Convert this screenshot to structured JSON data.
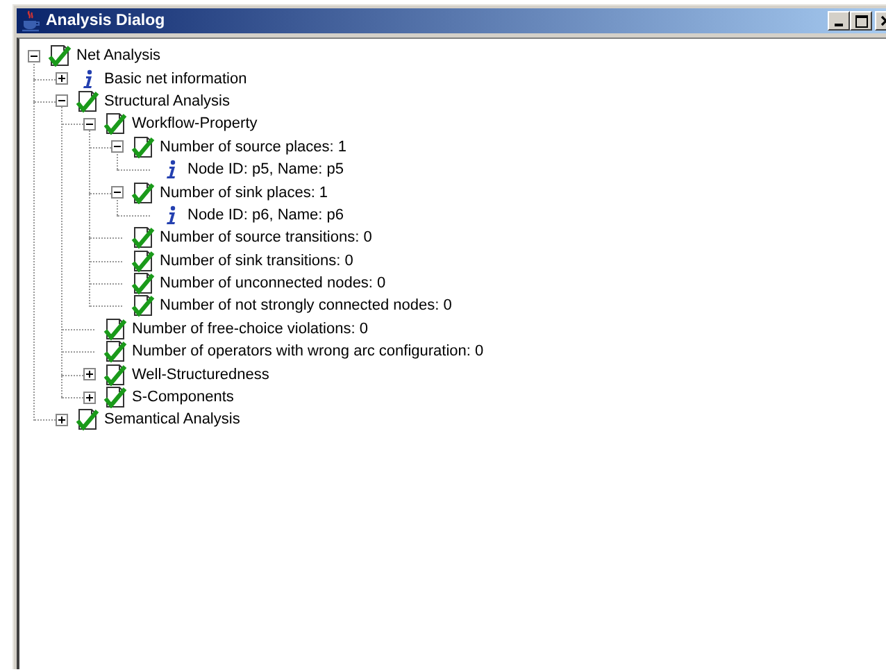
{
  "window": {
    "title": "Analysis Dialog"
  },
  "tree": [
    {
      "label": "Net Analysis",
      "kind": "check",
      "expanded": true,
      "children": [
        {
          "label": "Basic net information",
          "kind": "info",
          "expanded": false
        },
        {
          "label": "Structural Analysis",
          "kind": "check",
          "expanded": true,
          "children": [
            {
              "label": "Workflow-Property",
              "kind": "check",
              "expanded": true,
              "children": [
                {
                  "label": "Number of source places: 1",
                  "kind": "check",
                  "expanded": true,
                  "children": [
                    {
                      "label": "Node ID: p5, Name: p5",
                      "kind": "info"
                    }
                  ]
                },
                {
                  "label": "Number of sink places: 1",
                  "kind": "check",
                  "expanded": true,
                  "children": [
                    {
                      "label": "Node ID: p6, Name: p6",
                      "kind": "info"
                    }
                  ]
                },
                {
                  "label": "Number of source transitions: 0",
                  "kind": "check"
                },
                {
                  "label": "Number of sink transitions: 0",
                  "kind": "check"
                },
                {
                  "label": "Number of unconnected nodes: 0",
                  "kind": "check"
                },
                {
                  "label": "Number of not strongly connected nodes: 0",
                  "kind": "check"
                }
              ]
            },
            {
              "label": "Number of free-choice violations: 0",
              "kind": "check"
            },
            {
              "label": "Number of operators with wrong arc configuration: 0",
              "kind": "check"
            },
            {
              "label": "Well-Structuredness",
              "kind": "check",
              "expanded": false
            },
            {
              "label": "S-Components",
              "kind": "check",
              "expanded": false
            }
          ]
        },
        {
          "label": "Semantical Analysis",
          "kind": "check",
          "expanded": false
        }
      ]
    }
  ]
}
